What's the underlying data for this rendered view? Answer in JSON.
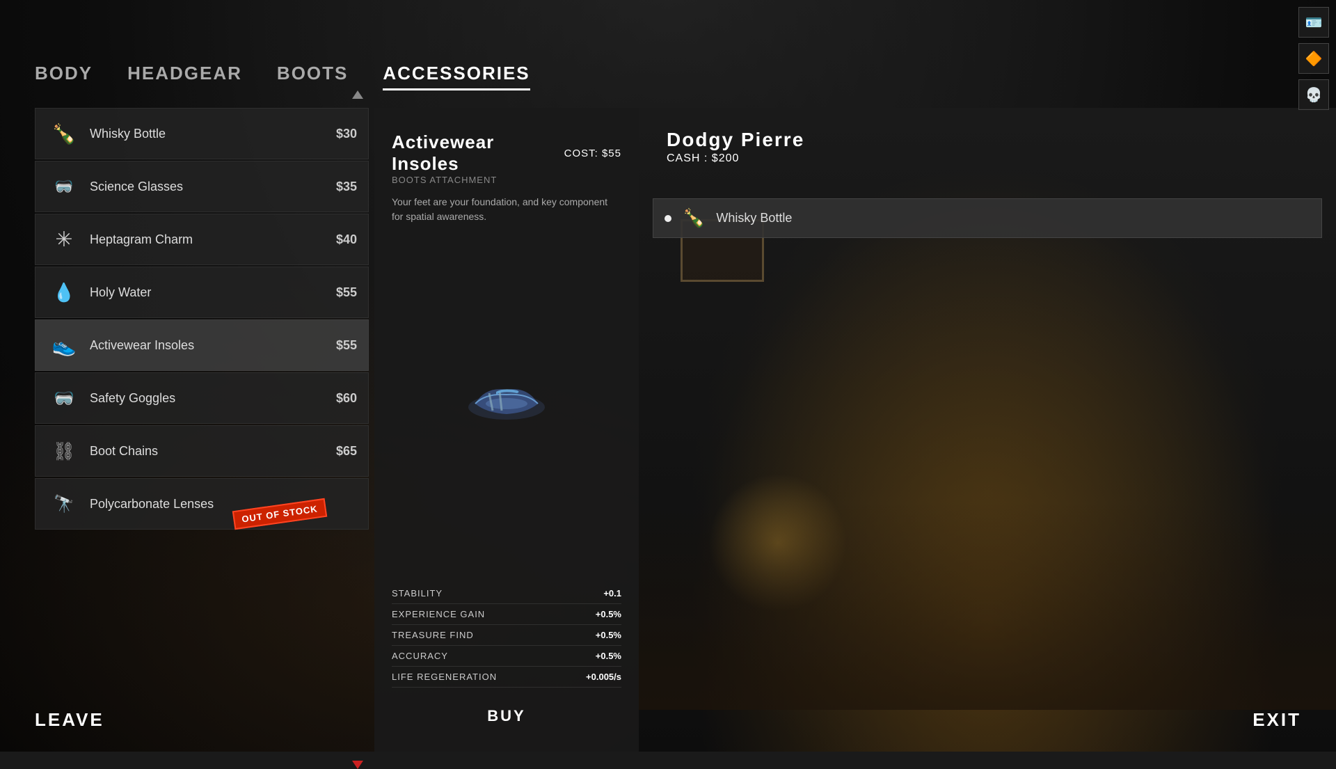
{
  "nav": {
    "tabs": [
      {
        "id": "body",
        "label": "BODY",
        "active": false
      },
      {
        "id": "headgear",
        "label": "HEADGEAR",
        "active": false
      },
      {
        "id": "boots",
        "label": "BOOTS",
        "active": false
      },
      {
        "id": "accessories",
        "label": "ACCESSORIES",
        "active": true
      }
    ]
  },
  "items": [
    {
      "id": "whisky-bottle",
      "name": "Whisky Bottle",
      "price": "$30",
      "icon": "🍾",
      "outOfStock": false
    },
    {
      "id": "science-glasses",
      "name": "Science Glasses",
      "price": "$35",
      "icon": "🥽",
      "outOfStock": false
    },
    {
      "id": "heptagram-charm",
      "name": "Heptagram Charm",
      "price": "$40",
      "icon": "✳",
      "outOfStock": false
    },
    {
      "id": "holy-water",
      "name": "Holy Water",
      "price": "$55",
      "icon": "💧",
      "outOfStock": false
    },
    {
      "id": "activewear-insoles",
      "name": "Activewear Insoles",
      "price": "$55",
      "icon": "👟",
      "selected": true,
      "outOfStock": false
    },
    {
      "id": "safety-goggles",
      "name": "Safety Goggles",
      "price": "$60",
      "icon": "🥽",
      "outOfStock": false
    },
    {
      "id": "boot-chains",
      "name": "Boot Chains",
      "price": "$65",
      "icon": "⛓",
      "outOfStock": false
    },
    {
      "id": "polycarbonate-lenses",
      "name": "Polycarbonate Lenses",
      "price": "",
      "icon": "🔭",
      "outOfStock": true,
      "outOfStockLabel": "OUT OF STOCK"
    }
  ],
  "detail": {
    "title": "Activewear Insoles",
    "subtitle": "Boots Attachment",
    "cost_label": "COST:",
    "cost_value": "$55",
    "description": "Your feet are your foundation, and key component for spatial awareness.",
    "stats": [
      {
        "name": "STABILITY",
        "value": "+0.1"
      },
      {
        "name": "EXPERIENCE GAIN",
        "value": "+0.5%"
      },
      {
        "name": "TREASURE FIND",
        "value": "+0.5%"
      },
      {
        "name": "ACCURACY",
        "value": "+0.5%"
      },
      {
        "name": "LIFE REGENERATION",
        "value": "+0.005/s"
      }
    ],
    "buy_label": "BUY"
  },
  "character": {
    "name": "Dodgy Pierre",
    "cash_label": "CASH :",
    "cash_value": "$200",
    "equipped_item": "Whisky Bottle"
  },
  "footer": {
    "leave": "LEAVE",
    "exit": "EXIT"
  },
  "top_icons": [
    "🪪",
    "🔶",
    "💀"
  ]
}
